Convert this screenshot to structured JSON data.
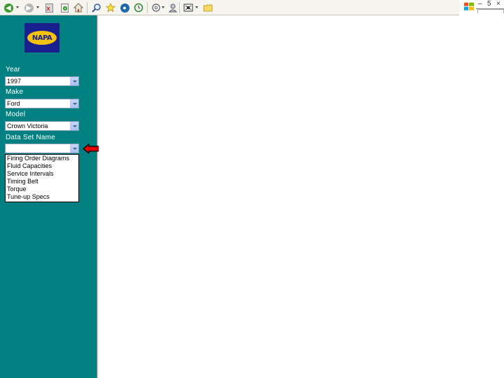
{
  "toolbar": {
    "icons": [
      "back-icon",
      "forward-icon",
      "stop-icon",
      "refresh-icon",
      "home-icon",
      "search-icon",
      "favorites-icon",
      "media-icon",
      "history-icon",
      "mail-icon",
      "print-icon",
      "edit-icon",
      "folder-icon"
    ]
  },
  "window_controls": {
    "minimize": "–",
    "restore": "5",
    "close": "×"
  },
  "sidebar": {
    "logo_text": "NAPA",
    "fields": [
      {
        "label": "Year",
        "value": "1997"
      },
      {
        "label": "Make",
        "value": "Ford"
      },
      {
        "label": "Model",
        "value": "Crown Victoria"
      },
      {
        "label": "Data Set Name",
        "value": ""
      }
    ],
    "dropdown_options": [
      "Firing Order Diagrams",
      "Fluid Capacities",
      "Service Intervals",
      "Timing Belt",
      "Torque",
      "Tune-up Specs"
    ]
  },
  "colors": {
    "sidebar": "#008080",
    "arrow": "#e00000"
  }
}
